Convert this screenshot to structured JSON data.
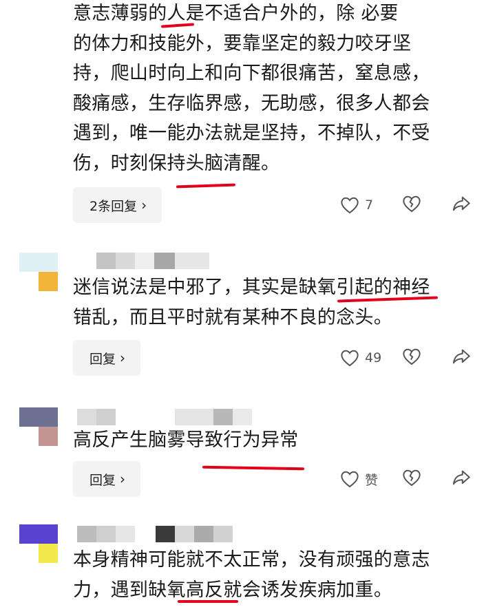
{
  "comments": [
    {
      "id": "c1",
      "avatar_colors": {
        "tl": "#5b87a6",
        "br": "#ffffff"
      },
      "text_lines": [
        "意志薄弱的人是不适合户外的，除      必要",
        "的体力和技能外，要靠坚定的毅力咬牙坚",
        "持，爬山时向上和向下都很痛苦，窒息感，",
        "酸痛感，生存临界感，无助感，很多人都会",
        "遇到，唯一能办法就是坚持，不掉队，不受",
        "伤，时刻保持头脑清醒。"
      ],
      "reply_label": "2条回复",
      "likes": "7"
    },
    {
      "id": "c2",
      "avatar_colors": {
        "tl": "#dff0f7",
        "br": "#f2b53a"
      },
      "text_lines": [
        "迷信说法是中邪了，其实是缺氧引起的神经",
        "错乱，而且平时就有某种不良的念头。"
      ],
      "reply_label": "回复",
      "likes": "49"
    },
    {
      "id": "c3",
      "avatar_colors": {
        "tl": "#6c7191",
        "br": "#c29592"
      },
      "text_lines": [
        "高反产生脑雾导致行为异常"
      ],
      "reply_label": "回复",
      "likes": "赞"
    },
    {
      "id": "c4",
      "avatar_colors": {
        "tl": "#5943ce",
        "br": "#f3e94d"
      },
      "text_lines": [
        "本身精神可能就不太正常，没有顽强的意志",
        "力，遇到缺氧高反就会诱发疾病加重。"
      ]
    }
  ],
  "colors": {
    "underline": "#e3001b",
    "icon": "#555555",
    "reply_bg": "#f3f3f3"
  },
  "icons": [
    "heart-outline-icon",
    "broken-heart-icon",
    "share-arrow-icon",
    "chevron-right-icon"
  ]
}
